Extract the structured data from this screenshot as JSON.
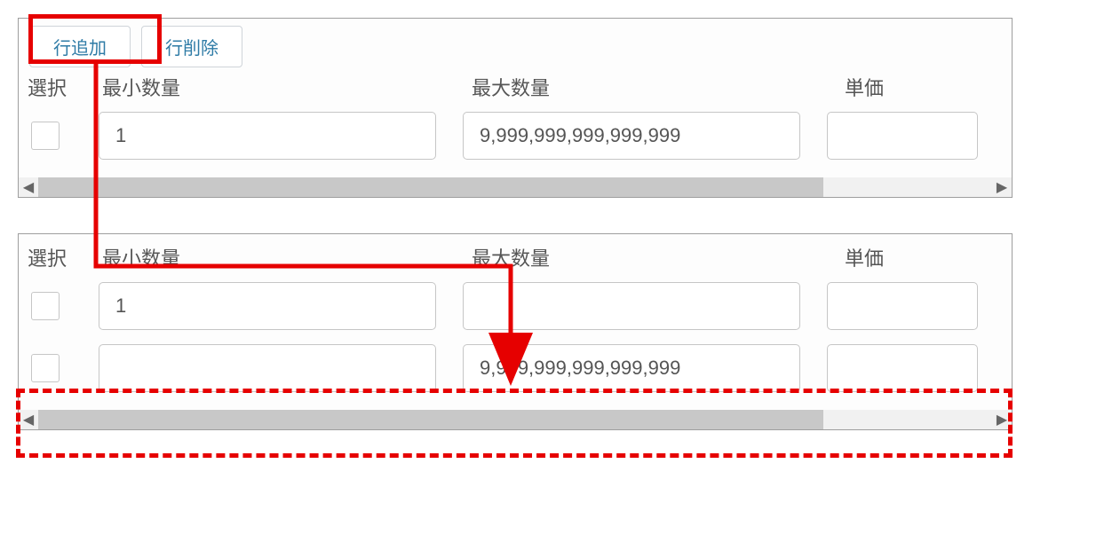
{
  "toolbar": {
    "add_row_label": "行追加",
    "delete_row_label": "行削除"
  },
  "columns": {
    "select": "選択",
    "min_qty": "最小数量",
    "max_qty": "最大数量",
    "unit_price": "単価"
  },
  "panel1": {
    "rows": [
      {
        "min": "1",
        "max": "9,999,999,999,999,999",
        "price": ""
      }
    ]
  },
  "panel2": {
    "rows": [
      {
        "min": "1",
        "max": "",
        "price": ""
      },
      {
        "min": "",
        "max": "9,999,999,999,999,999",
        "price": ""
      }
    ]
  }
}
